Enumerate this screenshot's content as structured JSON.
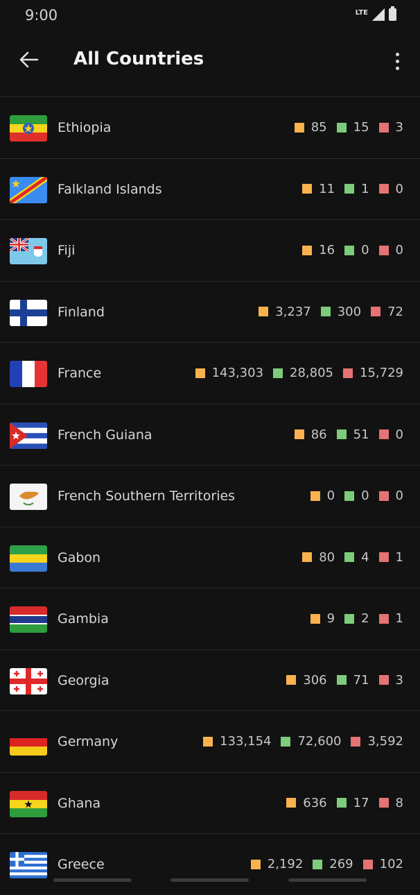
{
  "status": {
    "time": "9:00",
    "network": "LTE"
  },
  "appbar": {
    "title": "All Countries"
  },
  "colors": {
    "confirmed": "#f9b24e",
    "recovered": "#7ccc7c",
    "deaths": "#e57373"
  },
  "countries": [
    {
      "name": "Ethiopia",
      "flag": "ethiopia-flag",
      "confirmed": "85",
      "recovered": "15",
      "deaths": "3"
    },
    {
      "name": "Falkland Islands",
      "flag": "dr-congo-flag",
      "confirmed": "11",
      "recovered": "1",
      "deaths": "0"
    },
    {
      "name": "Fiji",
      "flag": "fiji-flag",
      "confirmed": "16",
      "recovered": "0",
      "deaths": "0"
    },
    {
      "name": "Finland",
      "flag": "finland-flag",
      "confirmed": "3,237",
      "recovered": "300",
      "deaths": "72"
    },
    {
      "name": "France",
      "flag": "france-flag",
      "confirmed": "143,303",
      "recovered": "28,805",
      "deaths": "15,729"
    },
    {
      "name": "French Guiana",
      "flag": "cuba-flag",
      "confirmed": "86",
      "recovered": "51",
      "deaths": "0"
    },
    {
      "name": "French Southern Territories",
      "flag": "cyprus-flag",
      "confirmed": "0",
      "recovered": "0",
      "deaths": "0"
    },
    {
      "name": "Gabon",
      "flag": "gabon-flag",
      "confirmed": "80",
      "recovered": "4",
      "deaths": "1"
    },
    {
      "name": "Gambia",
      "flag": "gambia-flag",
      "confirmed": "9",
      "recovered": "2",
      "deaths": "1"
    },
    {
      "name": "Georgia",
      "flag": "georgia-flag",
      "confirmed": "306",
      "recovered": "71",
      "deaths": "3"
    },
    {
      "name": "Germany",
      "flag": "germany-flag",
      "confirmed": "133,154",
      "recovered": "72,600",
      "deaths": "3,592"
    },
    {
      "name": "Ghana",
      "flag": "ghana-flag",
      "confirmed": "636",
      "recovered": "17",
      "deaths": "8"
    },
    {
      "name": "Greece",
      "flag": "greece-flag",
      "confirmed": "2,192",
      "recovered": "269",
      "deaths": "102"
    }
  ]
}
